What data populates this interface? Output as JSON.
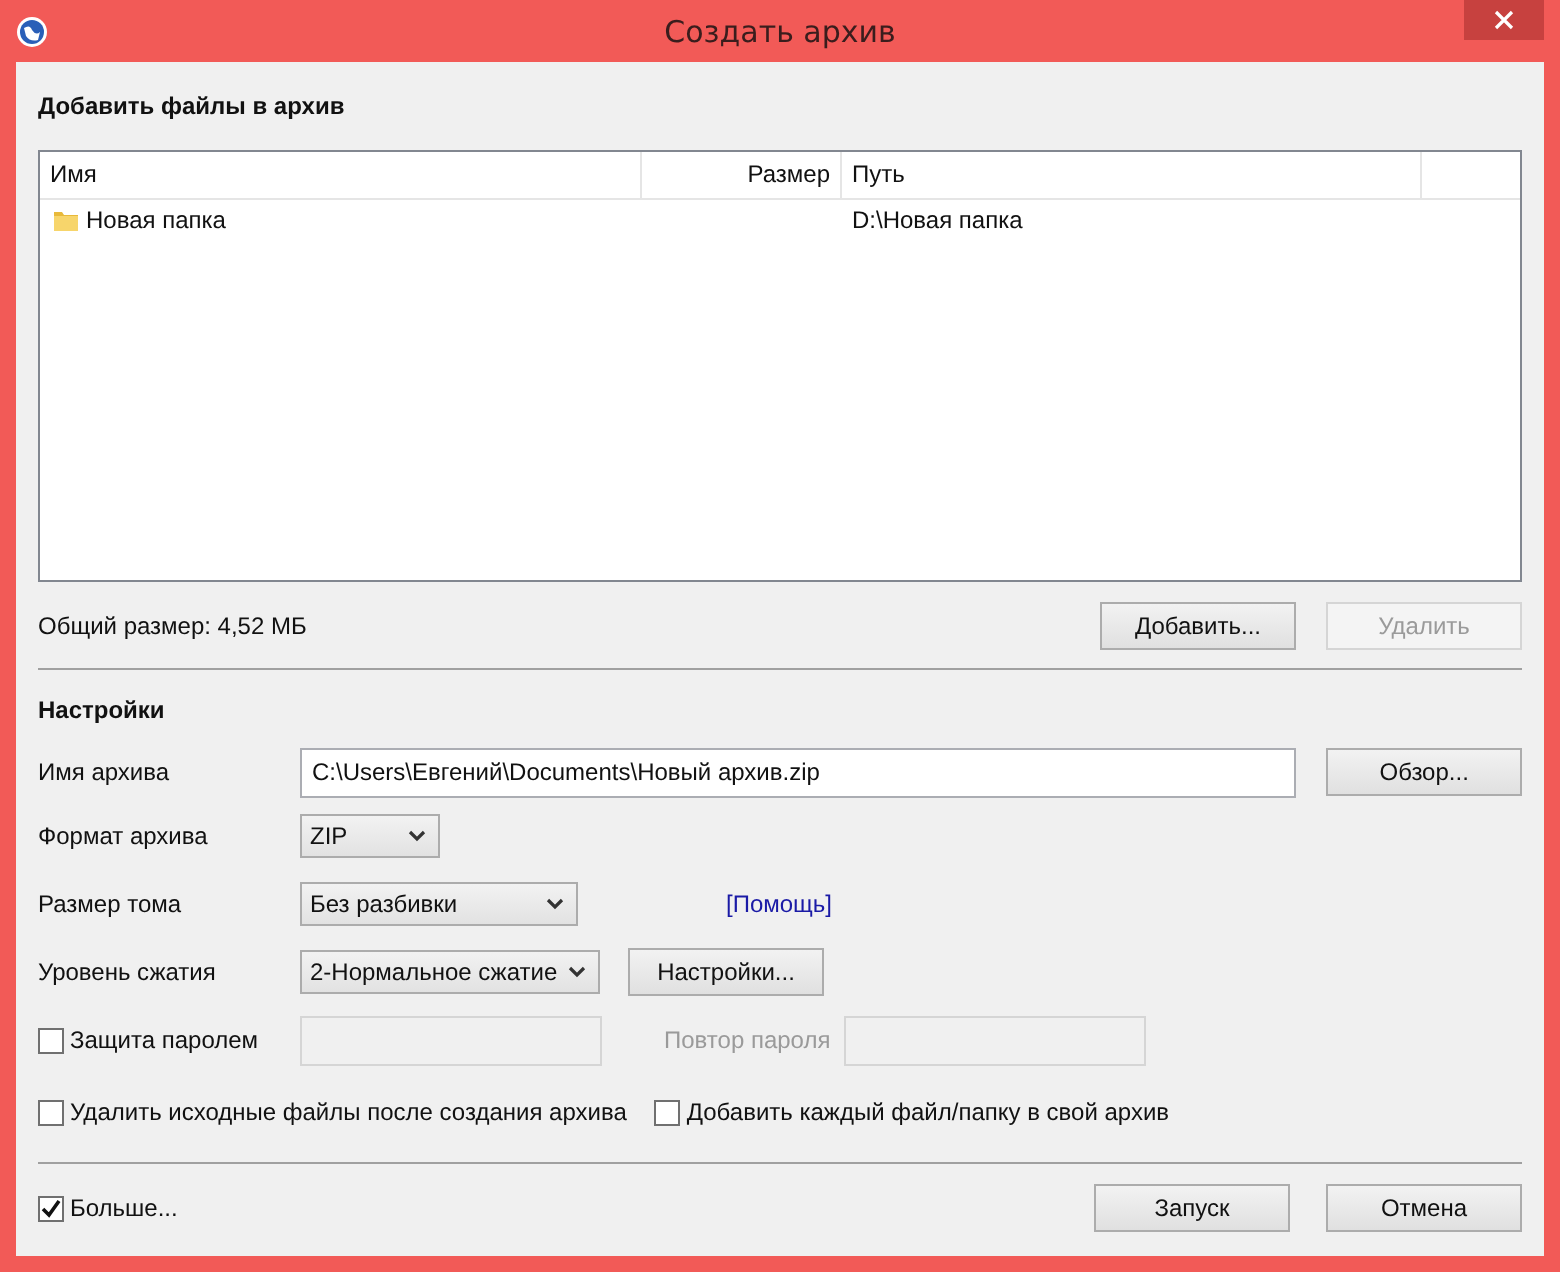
{
  "window": {
    "title": "Создать архив"
  },
  "files": {
    "heading": "Добавить файлы в архив",
    "columns": [
      {
        "label": "Имя"
      },
      {
        "label": "Размер"
      },
      {
        "label": "Путь"
      }
    ],
    "rows": [
      {
        "kind": "folder",
        "name": "Новая папка",
        "path": "D:\\Новая папка"
      }
    ],
    "total_size": "Общий размер: 4,52 МБ",
    "buttons": [
      {
        "label": "Добавить...",
        "disabled": false
      },
      {
        "label": "Удалить",
        "disabled": true
      }
    ]
  },
  "settings": {
    "heading": "Настройки",
    "archive_name": {
      "label": "Имя архива",
      "value": "C:\\Users\\Евгений\\Documents\\Новый архив.zip",
      "button": "Обзор..."
    },
    "format": {
      "label": "Формат архива",
      "value": "ZIP"
    },
    "volume_size": {
      "label": "Размер тома",
      "value": "Без разбивки",
      "link": "[Помощь]"
    },
    "compression": {
      "label": "Уровень сжатия",
      "value": "2-Нормальное сжатие",
      "button": "Настройки..."
    },
    "password": {
      "label": "Защита паролем",
      "checked": false,
      "repeat_label": "Повтор пароля",
      "disabled": true
    },
    "options": [
      {
        "label": "Удалить исходные файлы после создания архива",
        "checked": false
      },
      {
        "label": "Добавить каждый файл/папку в свой архив",
        "checked": false
      }
    ]
  },
  "footer": {
    "more": {
      "label": "Больше...",
      "checked": true
    },
    "buttons": [
      {
        "label": "Запуск"
      },
      {
        "label": "Отмена"
      }
    ]
  }
}
